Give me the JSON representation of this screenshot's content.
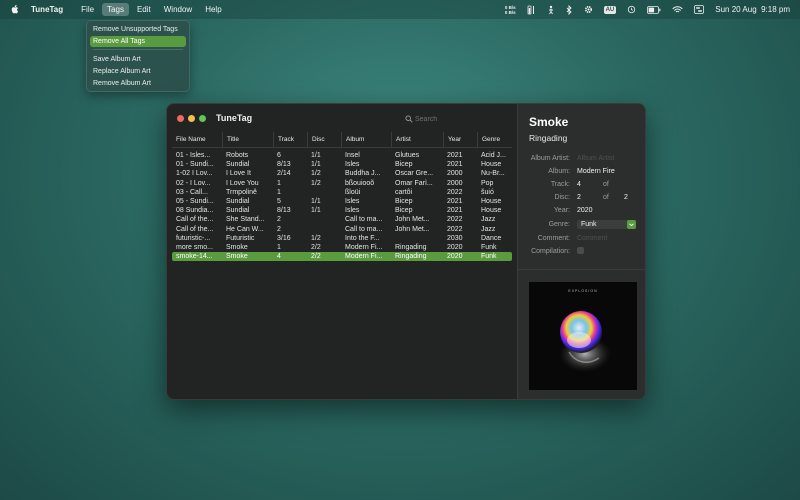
{
  "menubar": {
    "app_name": "TuneTag",
    "items": [
      "File",
      "Tags",
      "Edit",
      "Window",
      "Help"
    ],
    "active_item": "Tags",
    "net_up": "0 B/s",
    "net_down": "0 B/s",
    "keyboard": "AU",
    "date": "Sun 20 Aug",
    "time": "9:18 pm"
  },
  "tags_menu": {
    "items": [
      "Remove Unsupported Tags",
      "Remove All Tags",
      "Save Album Art",
      "Replace Album Art",
      "Remove Album Art"
    ],
    "highlighted": "Remove All Tags"
  },
  "window": {
    "title": "TuneTag",
    "search_placeholder": "Search"
  },
  "table": {
    "columns": [
      "File Name",
      "Title",
      "Track",
      "Disc",
      "Album",
      "Artist",
      "Year",
      "Genre"
    ],
    "rows": [
      [
        "01 - Isles...",
        "Robots",
        "6",
        "1/1",
        "Insel",
        "Glutues",
        "2021",
        "Acid J..."
      ],
      [
        "01 - Sundi...",
        "Sundial",
        "8/13",
        "1/1",
        "Isles",
        "Bicep",
        "2021",
        "House"
      ],
      [
        "1-02 I Lov...",
        "I Love It",
        "2/14",
        "1/2",
        "Buddha J...",
        "Oscar Gre...",
        "2000",
        "Nu-Br..."
      ],
      [
        "02 - I Lov...",
        "I Love You",
        "1",
        "1/2",
        "bßouiooõ",
        "Omar Farì...",
        "2000",
        "Pop"
      ],
      [
        "03 - Call...",
        "Trmpolinê",
        "1",
        "",
        "ßlοüi",
        "cartôi",
        "2022",
        "šuió"
      ],
      [
        "05 - Sundi...",
        "Sundial",
        "5",
        "1/1",
        "Isles",
        "Bicep",
        "2021",
        "House"
      ],
      [
        "08 Sundia...",
        "Sundial",
        "8/13",
        "1/1",
        "Isles",
        "Bicep",
        "2021",
        "House"
      ],
      [
        "Call of the...",
        "She Stand...",
        "2",
        "",
        "Call to ma...",
        "John Met...",
        "2022",
        "Jazz"
      ],
      [
        "Call of the...",
        "He Can W...",
        "2",
        "",
        "Call to ma...",
        "John Met...",
        "2022",
        "Jazz"
      ],
      [
        "futuristic-...",
        "Futuristic",
        "3/16",
        "1/2",
        "Into the F...",
        "",
        "2030",
        "Dance"
      ],
      [
        "more smo...",
        "Smoke",
        "1",
        "2/2",
        "Modern Fi...",
        "Ringading",
        "2020",
        "Funk"
      ],
      [
        "smoke-14...",
        "Smoke",
        "4",
        "2/2",
        "Modern Fi...",
        "Ringading",
        "2020",
        "Funk"
      ]
    ],
    "selected_index": 11
  },
  "inspector": {
    "title": "Smoke",
    "artist": "Ringading",
    "labels": {
      "album_artist": "Album Artist:",
      "album": "Album:",
      "track": "Track:",
      "disc": "Disc:",
      "year": "Year:",
      "genre": "Genre:",
      "comment": "Comment:",
      "compilation": "Compilation:",
      "of": "of"
    },
    "album_artist_placeholder": "Album Artist",
    "album": "Modern Fire",
    "track": "4",
    "track_total": "",
    "disc": "2",
    "disc_total": "2",
    "year": "2020",
    "genre": "Funk",
    "comment_placeholder": "Comment",
    "compilation": false,
    "art_caption": "EXPLOSION"
  },
  "colors": {
    "accent": "#5a9b3f",
    "close": "#ed6a5e",
    "minimize": "#f5bf4f",
    "zoom": "#62c554"
  }
}
